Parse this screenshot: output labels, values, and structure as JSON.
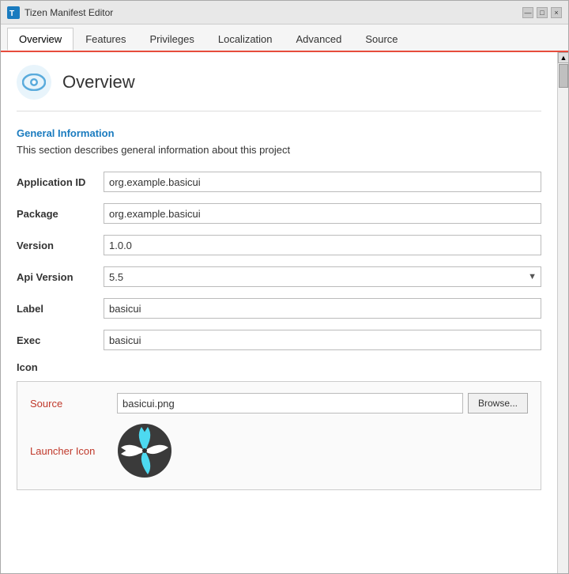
{
  "window": {
    "title": "Tizen Manifest Editor",
    "close_btn": "×",
    "minimize_btn": "—",
    "maximize_btn": "□"
  },
  "tabs": [
    {
      "id": "overview",
      "label": "Overview",
      "active": true
    },
    {
      "id": "features",
      "label": "Features",
      "active": false
    },
    {
      "id": "privileges",
      "label": "Privileges",
      "active": false
    },
    {
      "id": "localization",
      "label": "Localization",
      "active": false
    },
    {
      "id": "advanced",
      "label": "Advanced",
      "active": false
    },
    {
      "id": "source",
      "label": "Source",
      "active": false
    }
  ],
  "overview": {
    "title": "Overview",
    "section_title": "General Information",
    "section_desc": "This section describes general information about this project",
    "fields": {
      "app_id_label": "Application ID",
      "app_id_value": "org.example.basicui",
      "package_label": "Package",
      "package_value": "org.example.basicui",
      "version_label": "Version",
      "version_value": "1.0.0",
      "api_version_label": "Api Version",
      "api_version_value": "5.5",
      "label_label": "Label",
      "label_value": "basicui",
      "exec_label": "Exec",
      "exec_value": "basicui",
      "icon_label": "Icon"
    },
    "icon_box": {
      "source_label": "Source",
      "source_value": "basicui.png",
      "browse_label": "Browse...",
      "launcher_label": "Launcher Icon"
    }
  }
}
